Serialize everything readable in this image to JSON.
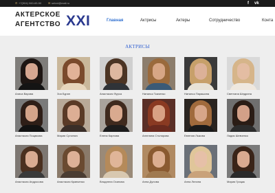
{
  "colors": {
    "accent": "#2f6fd0",
    "logo_blue": "#2b3a8f",
    "topbar": "#1b1b1b",
    "icon_gold": "#d7b46a"
  },
  "topbar": {
    "phone": "+7(904) 060-65-50",
    "email": "selxxi@mail.ru",
    "phone_icon": "phone-icon",
    "email_icon": "mail-icon",
    "social": [
      "f",
      "vk"
    ]
  },
  "logo": {
    "line1": "АКТЕРСКОЕ",
    "line2": "АГЕНТСТВО",
    "roman": "XXI"
  },
  "nav": [
    "Главная",
    "Актрисы",
    "Актеры",
    "Сотрудничество",
    "Конта"
  ],
  "section_title": "АКТРИСЫ",
  "actresses": [
    {
      "name": "Алиса Варова",
      "bg": "#7f7d7a",
      "hair": "#1e1613",
      "skin": "#d6a791",
      "cloth": "#141414"
    },
    {
      "name": "Зоя Бурян",
      "bg": "#c9b79a",
      "hair": "#7a4a2c",
      "skin": "#e1b297",
      "cloth": "#e7d6bc"
    },
    {
      "name": "Анастасия Фурса",
      "bg": "#cfcfcf",
      "hair": "#4b3424",
      "skin": "#ddb7a0",
      "cloth": "#2f3338"
    },
    {
      "name": "Наталья Ткаченко",
      "bg": "#8c7d6c",
      "hair": "#9a6a3c",
      "skin": "#d7a685",
      "cloth": "#3b5a76"
    },
    {
      "name": "Наталья Парашина",
      "bg": "#3a3a3a",
      "hair": "#c7a06a",
      "skin": "#dcb198",
      "cloth": "#e8e2d6"
    },
    {
      "name": "Светлана Шедрина",
      "bg": "#d9d9d9",
      "hair": "#d6b58a",
      "skin": "#e4bda3",
      "cloth": "#efe8df"
    },
    {
      "name": "Анастасия Пощвкова",
      "bg": "#7a7a7a",
      "hair": "#2e1e17",
      "skin": "#d4a48a",
      "cloth": "#121212"
    },
    {
      "name": "Мария Сргогвич",
      "bg": "#b8a998",
      "hair": "#5a3a26",
      "skin": "#dcae94",
      "cloth": "#3a2e28"
    },
    {
      "name": "Елена Карпова",
      "bg": "#a9a39c",
      "hair": "#3f2a1e",
      "skin": "#d9aa8f",
      "cloth": "#1c1c1c"
    },
    {
      "name": "Ангелина Столярова",
      "bg": "#5a2f27",
      "hair": "#8a3a22",
      "skin": "#d8a184",
      "cloth": "#6a2a1e"
    },
    {
      "name": "Евгения Лыкова",
      "bg": "#2a2420",
      "hair": "#a06a3c",
      "skin": "#d7a689",
      "cloth": "#1a1a1a"
    },
    {
      "name": "Лидия Шевченко",
      "bg": "#6f6f6f",
      "hair": "#2a1c15",
      "skin": "#d2a088",
      "cloth": "#2c2c2c"
    },
    {
      "name": "Анастасия Андросова",
      "bg": "#7d7772",
      "hair": "#4a3020",
      "skin": "#d8ab92",
      "cloth": "#3a3a3a"
    },
    {
      "name": "Анастасия Кравченко",
      "bg": "#8a7a6a",
      "hair": "#6a4a30",
      "skin": "#ddb197",
      "cloth": "#4a3c32"
    },
    {
      "name": "Владлена Осипова",
      "bg": "#9a8a78",
      "hair": "#b58a5a",
      "skin": "#e0b598",
      "cloth": "#d8c8b0"
    },
    {
      "name": "Анна Дулова",
      "bg": "#b08a62",
      "hair": "#8a5a30",
      "skin": "#dcae90",
      "cloth": "#a07a50"
    },
    {
      "name": "Анна Лелина",
      "bg": "#6a7078",
      "hair": "#e0c69a",
      "skin": "#e6c0a8",
      "cloth": "#c9a27a"
    },
    {
      "name": "Мария Грицак",
      "bg": "#7a7a7a",
      "hair": "#3a2418",
      "skin": "#d9aa90",
      "cloth": "#2a2a2a"
    }
  ]
}
